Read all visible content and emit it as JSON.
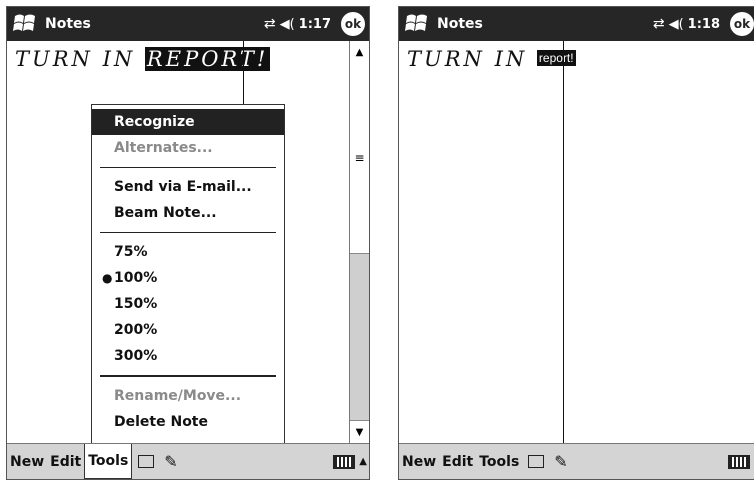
{
  "screens": {
    "left": {
      "title": "Notes",
      "clock": "1:17",
      "ok_label": "ok",
      "handwriting": "TURN IN ",
      "handwriting_selected": "REPORT!",
      "popup_menu": {
        "items": [
          {
            "label": "Recognize",
            "state": "selected"
          },
          {
            "label": "Alternates...",
            "state": "disabled"
          },
          {
            "label": "Send via E-mail...",
            "state": "normal"
          },
          {
            "label": "Beam Note...",
            "state": "normal"
          },
          {
            "label": "75%",
            "state": "normal"
          },
          {
            "label": "100%",
            "state": "checked"
          },
          {
            "label": "150%",
            "state": "normal"
          },
          {
            "label": "200%",
            "state": "normal"
          },
          {
            "label": "300%",
            "state": "normal"
          },
          {
            "label": "Rename/Move...",
            "state": "disabled"
          },
          {
            "label": "Delete Note",
            "state": "normal"
          }
        ]
      },
      "menubar": {
        "new": "New",
        "edit": "Edit",
        "tools": "Tools"
      }
    },
    "right": {
      "title": "Notes",
      "clock": "1:18",
      "ok_label": "ok",
      "handwriting": "TURN IN ",
      "recognized_text": "report!",
      "menubar": {
        "new": "New",
        "edit": "Edit",
        "tools": "Tools"
      }
    }
  },
  "icons": {
    "start": "windows-flag-icon",
    "connectivity": "connectivity-icon",
    "volume": "speaker-icon",
    "scroll_thumb": "grip-icon",
    "recording": "recording-toolbar-icon",
    "pen": "pen-icon",
    "keyboard": "keyboard-icon",
    "sip_arrow": "up-arrow-icon"
  },
  "colors": {
    "titlebar": "#262626",
    "menubar": "#d4d4d4",
    "selection": "#222222",
    "disabled_text": "#8a8a8a"
  }
}
